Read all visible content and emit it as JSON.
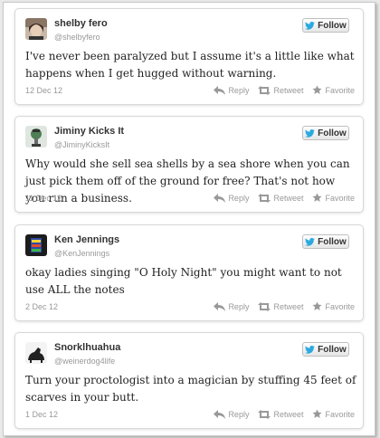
{
  "actions": {
    "reply": "Reply",
    "retweet": "Retweet",
    "favorite": "Favorite"
  },
  "follow_label": "Follow",
  "tweets": [
    {
      "name": "shelby fero",
      "handle": "@shelbyfero",
      "text": "I've never been paralyzed but I assume it's a little like what happens when I get hugged without warning.",
      "date": "12 Dec 12"
    },
    {
      "name": "Jiminy Kicks It",
      "handle": "@JiminyKicksIt",
      "text": "Why would she sell sea shells by a sea shore when you can just pick them off of the ground for free? That's not how you run a business.",
      "date": "11 Dec 12"
    },
    {
      "name": "Ken Jennings",
      "handle": "@KenJennings",
      "text": "okay ladies singing \"O Holy Night\" you might want to not use ALL the notes",
      "date": "2 Dec 12"
    },
    {
      "name": "Snorklhuahua",
      "handle": "@weinerdog4life",
      "text": "Turn your proctologist into a magician by stuffing 45 feet of scarves in your butt.",
      "date": "1 Dec 12"
    }
  ],
  "colors": {
    "follow_bird": "#2aa9e0",
    "action_gray": "#999999",
    "card_border": "#d8d8d8"
  }
}
